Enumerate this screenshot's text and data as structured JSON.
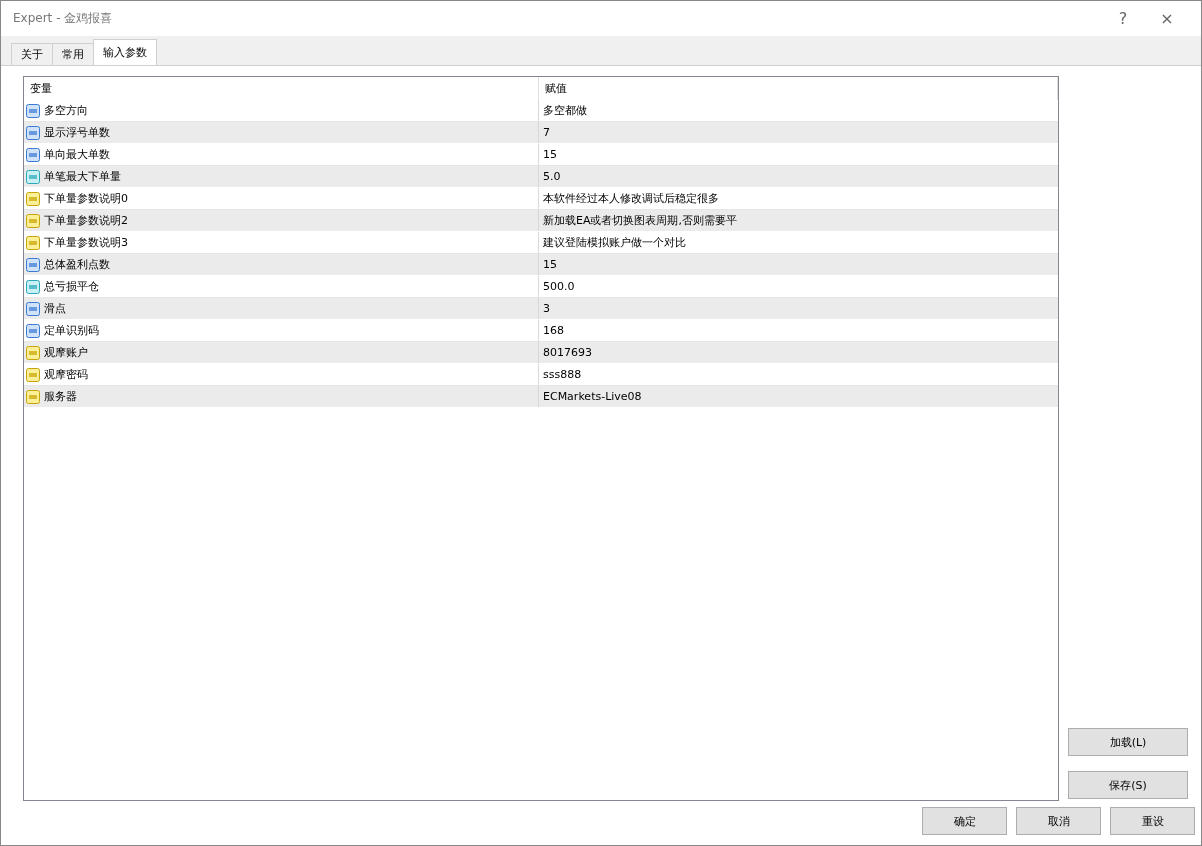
{
  "window": {
    "title": "Expert - 金鸡报喜",
    "help": "?",
    "close": "×"
  },
  "tabs": [
    {
      "label": "关于",
      "selected": false
    },
    {
      "label": "常用",
      "selected": false
    },
    {
      "label": "输入参数",
      "selected": true
    }
  ],
  "table": {
    "columns": [
      "变量",
      "赋值"
    ],
    "rows": [
      {
        "kind": "int",
        "name": "多空方向",
        "value": "多空都做"
      },
      {
        "kind": "int",
        "name": "显示浮号单数",
        "value": "7"
      },
      {
        "kind": "int",
        "name": "单向最大单数",
        "value": "15"
      },
      {
        "kind": "double",
        "name": "单笔最大下单量",
        "value": "5.0"
      },
      {
        "kind": "string",
        "name": "下单量参数说明0",
        "value": "本软件经过本人修改调试后稳定很多"
      },
      {
        "kind": "string",
        "name": "下单量参数说明2",
        "value": "新加载EA或者切换图表周期,否则需要平"
      },
      {
        "kind": "string",
        "name": "下单量参数说明3",
        "value": "建议登陆模拟账户做一个对比"
      },
      {
        "kind": "int",
        "name": "总体盈利点数",
        "value": "15"
      },
      {
        "kind": "double",
        "name": "总亏损平仓",
        "value": "500.0"
      },
      {
        "kind": "int",
        "name": "滑点",
        "value": "3"
      },
      {
        "kind": "int",
        "name": "定单识别码",
        "value": "168"
      },
      {
        "kind": "string",
        "name": "观摩账户",
        "value": "8017693"
      },
      {
        "kind": "string",
        "name": "观摩密码",
        "value": "sss888"
      },
      {
        "kind": "string",
        "name": "服务器",
        "value": "ECMarkets-Live08"
      }
    ]
  },
  "side_buttons": [
    "加载(L)",
    "保存(S)"
  ],
  "bottom_buttons": [
    "确定",
    "取消",
    "重设"
  ]
}
